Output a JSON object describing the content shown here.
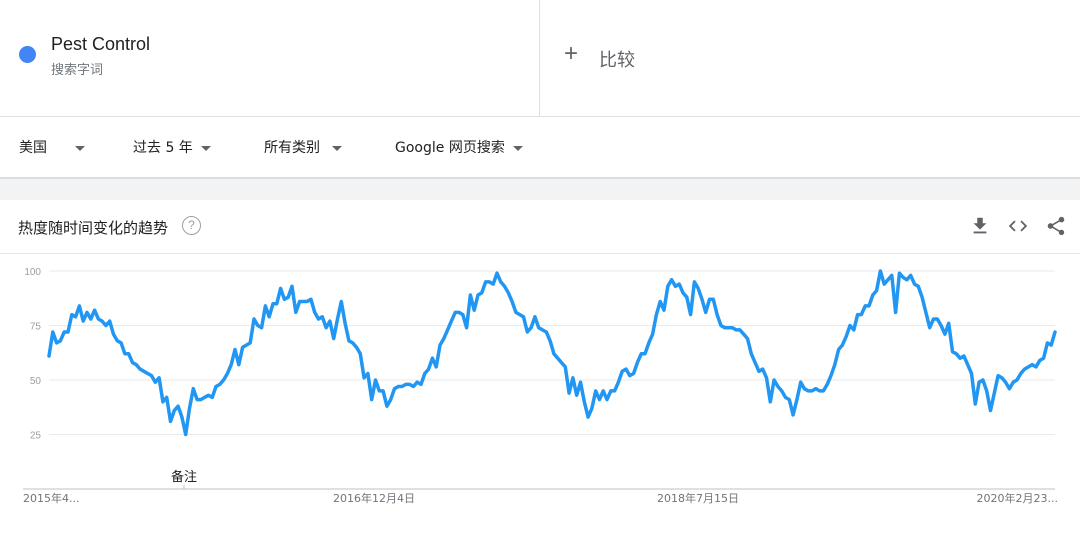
{
  "term": {
    "name": "Pest Control",
    "type": "搜索字词",
    "color": "#4285f4"
  },
  "compare": {
    "plus": "+",
    "label": "比较"
  },
  "filters": [
    {
      "label": "美国"
    },
    {
      "label": "过去 5 年"
    },
    {
      "label": "所有类别"
    },
    {
      "label": "Google 网页搜索"
    }
  ],
  "card": {
    "title": "热度随时间变化的趋势",
    "help": "?",
    "icons": [
      "download-icon",
      "embed-icon",
      "share-icon"
    ]
  },
  "note_label": "备注",
  "chart_data": {
    "type": "line",
    "line_color": "#2196f3",
    "ylim": [
      0,
      100
    ],
    "y_ticks": [
      25,
      50,
      75,
      100
    ],
    "x_tick_labels": [
      "2015年4...",
      "2016年12月4日",
      "2018年7月15日",
      "2020年2月23..."
    ],
    "series": [
      {
        "values": [
          61,
          72,
          67,
          68,
          72,
          72,
          80,
          79,
          84,
          77,
          81,
          78,
          82,
          78,
          77,
          75,
          77,
          71,
          68,
          67,
          62,
          62,
          58,
          57,
          55,
          54,
          53,
          52,
          49,
          51,
          40,
          42,
          31,
          36,
          38,
          33,
          25,
          37,
          46,
          41,
          41,
          42,
          43,
          42,
          47,
          48,
          50,
          53,
          57,
          64,
          57,
          65,
          66,
          67,
          78,
          75,
          74,
          84,
          79,
          85,
          85,
          92,
          87,
          88,
          93,
          81,
          86,
          86,
          86,
          87,
          81,
          78,
          79,
          74,
          77,
          69,
          78,
          86,
          76,
          68,
          67,
          65,
          62,
          51,
          53,
          41,
          50,
          45,
          45,
          38,
          41,
          46,
          47,
          47,
          48,
          48,
          47,
          49,
          48,
          53,
          55,
          60,
          56,
          66,
          69,
          73,
          77,
          81,
          81,
          80,
          74,
          89,
          82,
          89,
          90,
          95,
          95,
          94,
          99,
          95,
          93,
          90,
          86,
          81,
          80,
          79,
          72,
          74,
          79,
          74,
          73,
          72,
          68,
          62,
          60,
          58,
          56,
          44,
          51,
          43,
          49,
          40,
          33,
          37,
          45,
          41,
          45,
          41,
          45,
          45,
          49,
          54,
          55,
          52,
          53,
          58,
          62,
          62,
          67,
          71,
          80,
          86,
          82,
          93,
          96,
          93,
          94,
          90,
          88,
          80,
          95,
          92,
          87,
          81,
          87,
          87,
          80,
          75,
          74,
          74,
          74,
          73,
          73,
          71,
          69,
          62,
          58,
          54,
          55,
          51,
          40,
          50,
          47,
          45,
          42,
          41,
          34,
          41,
          49,
          46,
          45,
          45,
          46,
          45,
          45,
          48,
          52,
          57,
          64,
          66,
          70,
          75,
          73,
          80,
          80,
          84,
          84,
          89,
          91,
          100,
          94,
          96,
          98,
          81,
          99,
          97,
          96,
          98,
          94,
          93,
          88,
          81,
          74,
          78,
          78,
          75,
          71,
          76,
          63,
          62,
          60,
          61,
          57,
          53,
          39,
          49,
          50,
          45,
          36,
          44,
          52,
          51,
          49,
          46,
          49,
          50,
          53,
          55,
          56,
          57,
          56,
          59,
          60,
          67,
          66,
          72
        ]
      }
    ]
  }
}
